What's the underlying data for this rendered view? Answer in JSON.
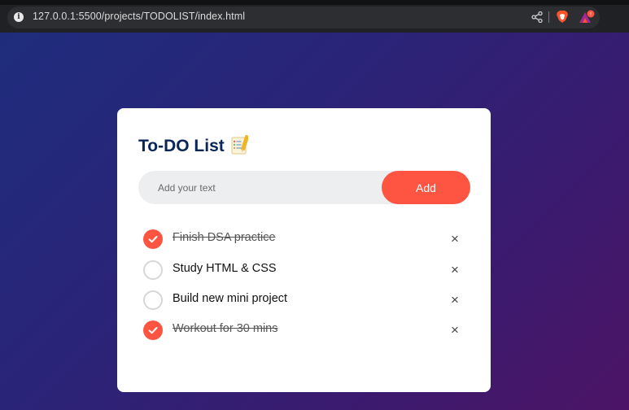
{
  "browser": {
    "url": "127.0.0.1:5500/projects/TODOLIST/index.html",
    "info_icon": "i",
    "rewards_badge_color": "#fe5543"
  },
  "app": {
    "title": "To-DO List",
    "title_icon": "notepad-checklist-icon",
    "input_placeholder": "Add your text",
    "input_value": "",
    "add_label": "Add",
    "accent_color": "#fe5543",
    "title_color": "#0a2557",
    "close_glyph": "×",
    "tasks": [
      {
        "text": "Finish DSA practice",
        "done": true
      },
      {
        "text": "Study HTML & CSS",
        "done": false
      },
      {
        "text": "Build new mini project",
        "done": false
      },
      {
        "text": "Workout for 30 mins",
        "done": true
      }
    ]
  }
}
